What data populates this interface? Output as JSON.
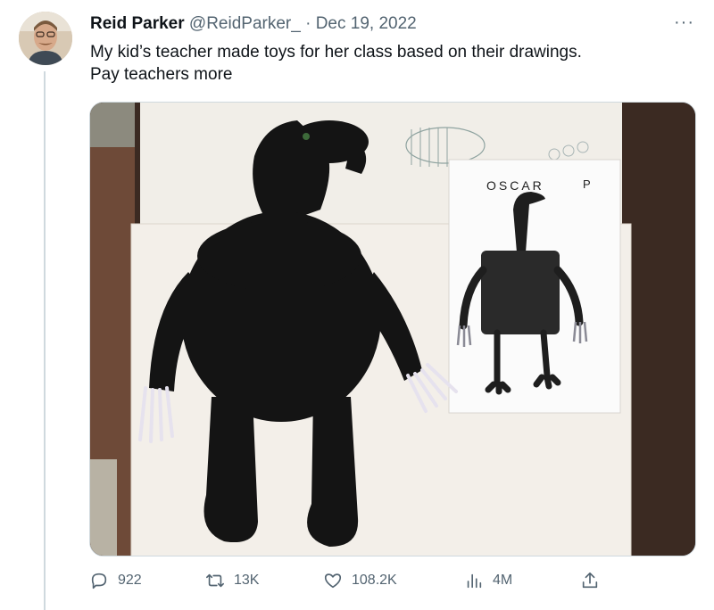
{
  "tweet": {
    "display_name": "Reid Parker",
    "handle": "@ReidParker_",
    "separator": "·",
    "date": "Dec 19, 2022",
    "more_label": "···",
    "text_lines": [
      "My kid’s teacher made toys for her class based on their drawings.",
      "Pay teachers more"
    ]
  },
  "media": {
    "drawing_caption_name": "OSCAR",
    "drawing_caption_initial": "P"
  },
  "actions": {
    "replies": "922",
    "retweets": "13K",
    "likes": "108.2K",
    "views": "4M"
  },
  "icons": {
    "reply": "speech-bubble-icon",
    "retweet": "retweet-arrows-icon",
    "like": "heart-icon",
    "views": "bar-chart-icon",
    "share": "share-upload-icon"
  },
  "colors": {
    "text_primary": "#0f1419",
    "text_secondary": "#536471",
    "border": "#cfd9de"
  }
}
